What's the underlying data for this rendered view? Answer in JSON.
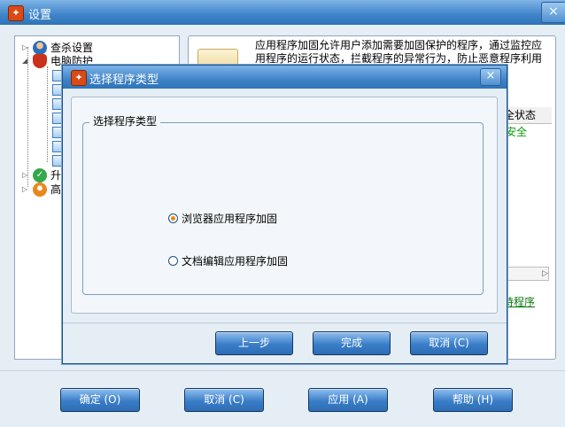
{
  "window": {
    "title": "设置",
    "close_glyph": "×"
  },
  "tree": {
    "items": [
      {
        "label": "查杀设置",
        "icon": "user-shield-icon"
      },
      {
        "label": "电脑防护",
        "icon": "shield-icon"
      },
      {
        "label": "升",
        "icon": "check-icon"
      },
      {
        "label": "高",
        "icon": "gear-icon"
      }
    ]
  },
  "right_panel": {
    "description": "应用程序加固允许用户添加需要加固保护的程序，通过监控应用程序的运行状态，拦截程序的异常行为，防止恶意程序利用应用程序存在的漏洞对用户计算机进行破坏",
    "column_header_fragment": "全状态",
    "status_fragment": "安全",
    "link_fragment": "持程序"
  },
  "dialog": {
    "title": "选择程序类型",
    "close_glyph": "×",
    "group_label": "选择程序类型",
    "options": [
      {
        "label": "浏览器应用程序加固",
        "selected": true
      },
      {
        "label": "文档编辑应用程序加固",
        "selected": false
      }
    ],
    "buttons": {
      "prev": "上一步",
      "finish": "完成",
      "cancel": "取消 (C)"
    }
  },
  "footer": {
    "ok": "确定 (O)",
    "cancel": "取消 (C)",
    "apply": "应用 (A)",
    "help": "帮助 (H)"
  },
  "colors": {
    "accent": "#3a7ec8",
    "title": "#3f84c9",
    "safe_green": "#0a9a0a"
  }
}
